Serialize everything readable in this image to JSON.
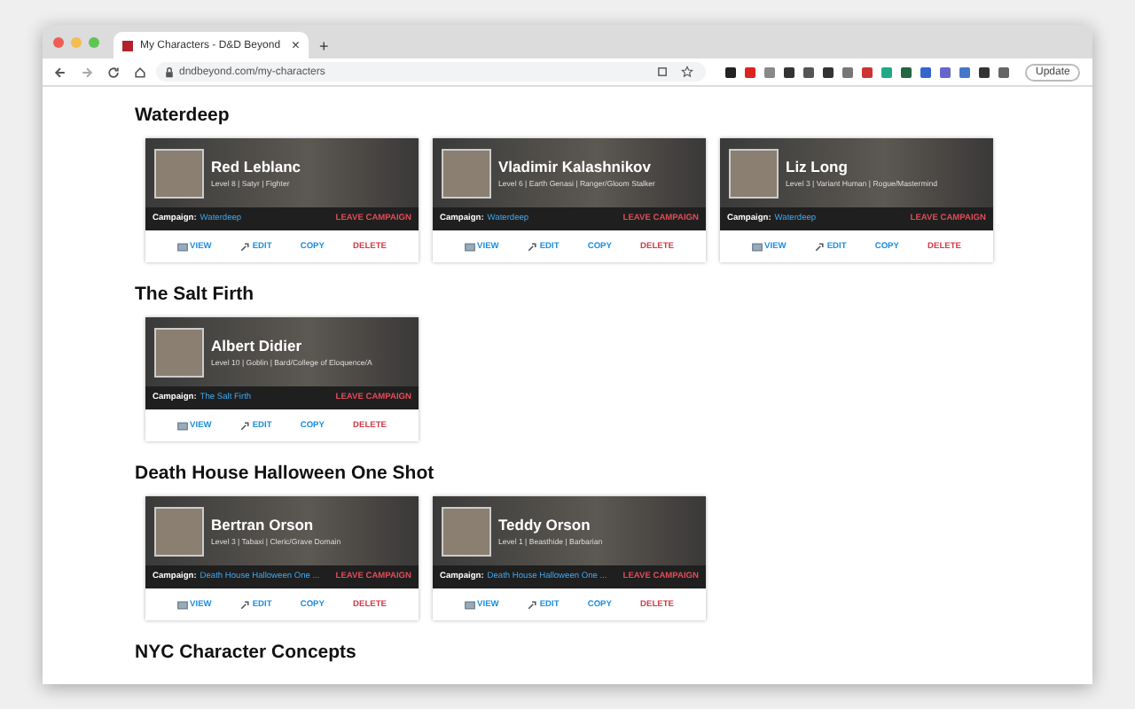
{
  "browser": {
    "tab_title": "My Characters - D&D Beyond",
    "tab_close": "×",
    "new_tab": "+",
    "url": "dndbeyond.com/my-characters",
    "update_button": "Update"
  },
  "sections": [
    {
      "title": "Waterdeep",
      "characters": [
        {
          "name": "Red Leblanc",
          "subtitle": "Level 8 | Satyr | Fighter",
          "campaign_label": "Campaign:",
          "campaign": "Waterdeep",
          "leave": "LEAVE CAMPAIGN",
          "actions": [
            {
              "kind": "view",
              "label": "VIEW"
            },
            {
              "kind": "edit",
              "label": "EDIT"
            },
            {
              "kind": "copy",
              "label": "COPY"
            },
            {
              "kind": "delete",
              "label": "DELETE"
            }
          ]
        },
        {
          "name": "Vladimir Kalashnikov",
          "subtitle": "Level 6 | Earth Genasi | Ranger/Gloom Stalker",
          "campaign_label": "Campaign:",
          "campaign": "Waterdeep",
          "leave": "LEAVE CAMPAIGN",
          "actions": [
            {
              "kind": "view",
              "label": "VIEW"
            },
            {
              "kind": "edit",
              "label": "EDIT"
            },
            {
              "kind": "copy",
              "label": "COPY"
            },
            {
              "kind": "delete",
              "label": "DELETE"
            }
          ]
        },
        {
          "name": "Liz Long",
          "subtitle": "Level 3 | Variant Human | Rogue/Mastermind",
          "campaign_label": "Campaign:",
          "campaign": "Waterdeep",
          "leave": "LEAVE CAMPAIGN",
          "actions": [
            {
              "kind": "view",
              "label": "VIEW"
            },
            {
              "kind": "edit",
              "label": "EDIT"
            },
            {
              "kind": "copy",
              "label": "COPY"
            },
            {
              "kind": "delete",
              "label": "DELETE"
            }
          ]
        }
      ]
    },
    {
      "title": "The Salt Firth",
      "characters": [
        {
          "name": "Albert Didier",
          "subtitle": "Level 10 | Goblin | Bard/College of Eloquence/A",
          "campaign_label": "Campaign:",
          "campaign": "The Salt Firth",
          "leave": "LEAVE CAMPAIGN",
          "actions": [
            {
              "kind": "view",
              "label": "VIEW"
            },
            {
              "kind": "edit",
              "label": "EDIT"
            },
            {
              "kind": "copy",
              "label": "COPY"
            },
            {
              "kind": "delete",
              "label": "DELETE"
            }
          ]
        }
      ]
    },
    {
      "title": "Death House Halloween One Shot",
      "characters": [
        {
          "name": "Bertran Orson",
          "subtitle": "Level 3 | Tabaxi | Cleric/Grave Domain",
          "campaign_label": "Campaign:",
          "campaign": "Death House Halloween One ...",
          "leave": "LEAVE CAMPAIGN",
          "actions": [
            {
              "kind": "view",
              "label": "VIEW"
            },
            {
              "kind": "edit",
              "label": "EDIT"
            },
            {
              "kind": "copy",
              "label": "COPY"
            },
            {
              "kind": "delete",
              "label": "DELETE"
            }
          ]
        },
        {
          "name": "Teddy Orson",
          "subtitle": "Level 1 | Beasthide | Barbarian",
          "campaign_label": "Campaign:",
          "campaign": "Death House Halloween One ...",
          "leave": "LEAVE CAMPAIGN",
          "actions": [
            {
              "kind": "view",
              "label": "VIEW"
            },
            {
              "kind": "edit",
              "label": "EDIT"
            },
            {
              "kind": "copy",
              "label": "COPY"
            },
            {
              "kind": "delete",
              "label": "DELETE"
            }
          ]
        }
      ]
    },
    {
      "title": "NYC Character Concepts"
    }
  ]
}
